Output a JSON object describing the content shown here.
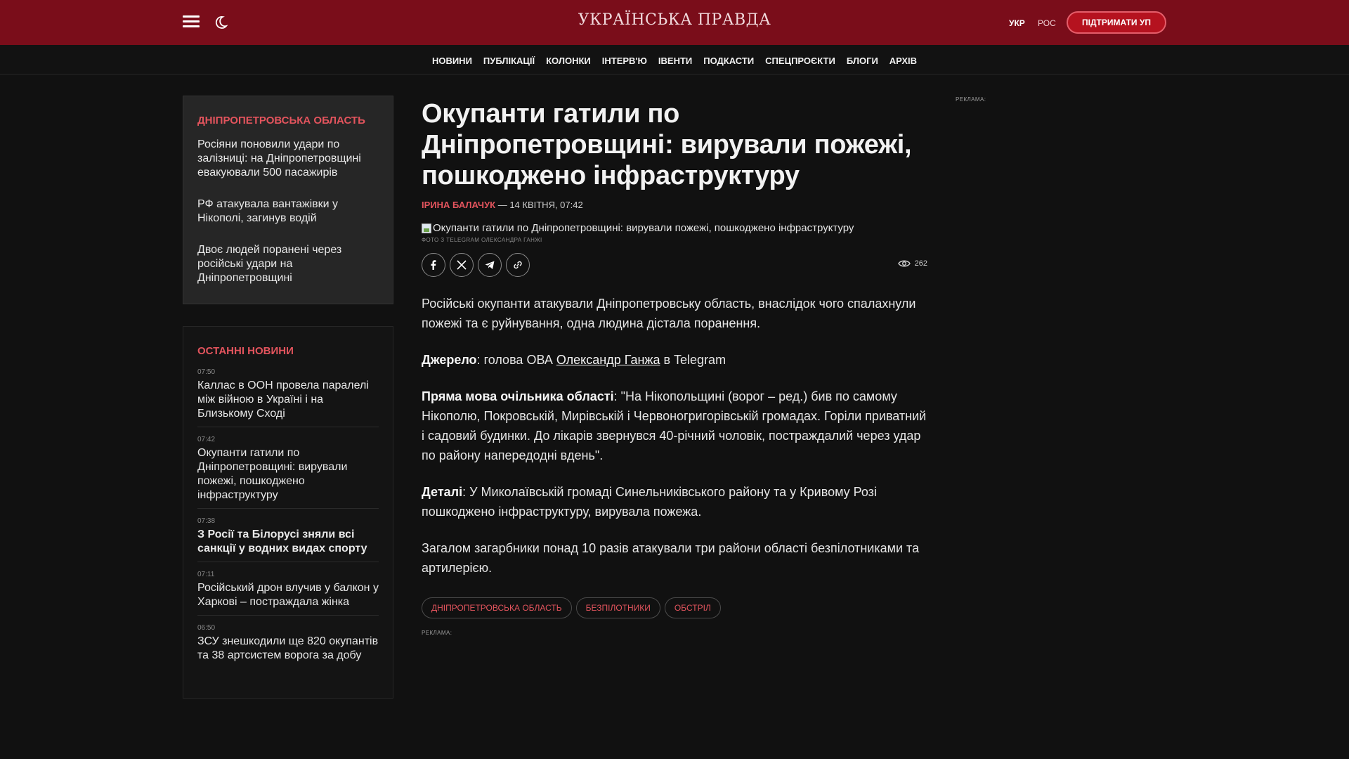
{
  "header": {
    "logo": "УКРАЇНСЬКА ПРАВДА",
    "lang_ukr": "УКР",
    "lang_ros": "РОС",
    "support": "ПІДТРИМАТИ УП",
    "accent": "#7a0d1a"
  },
  "nav": {
    "items": [
      "НОВИНИ",
      "ПУБЛІКАЦІЇ",
      "КОЛОНКИ",
      "ІНТЕРВ'Ю",
      "ІВЕНТИ",
      "ПОДКАСТИ",
      "СПЕЦПРОЄКТИ",
      "БЛОГИ",
      "АРХІВ"
    ]
  },
  "region": {
    "title": "ДНІПРОПЕТРОВСЬКА ОБЛАСТЬ",
    "items": [
      "Росіяни поновили удари по залізниці: на Дніпропетровщині евакуювали 500 пасажирів",
      "РФ атакувала вантажівки у Нікополі, загинув водій",
      "Двоє людей поранені через російські удари на Дніпропетровщині"
    ]
  },
  "latest": {
    "title": "ОСТАННІ НОВИНИ",
    "items": [
      {
        "time": "07:50",
        "title": "Каллас в ООН провела паралелі між війною в Україні і на Близькому Сході"
      },
      {
        "time": "07:42",
        "title": "Окупанти гатили по Дніпропетровщині: вирували пожежі, пошкоджено інфраструктуру"
      },
      {
        "time": "07:38",
        "title": "З Росії та Білорусі зняли всі санкції у водних видах спорту"
      },
      {
        "time": "07:11",
        "title": "Російський дрон влучив у балкон у Харкові – постраждала жінка"
      },
      {
        "time": "06:50",
        "title": "ЗСУ знешкодили ще 820 окупантів та 38 артсистем ворога за добу"
      }
    ]
  },
  "article": {
    "title": "Окупанти гатили по Дніпропетровщині: вирували пожежі, пошкоджено інфраструктуру",
    "author": "ІРИНА БАЛАЧУК",
    "date": " — 14 КВІТНЯ, 07:42",
    "image_alt": "Окупанти гатили по Дніпропетровщині: вирували пожежі, пошкоджено інфраструктуру",
    "photo_credit": "ФОТО З TELEGRAM ОЛЕКСАНДРА ГАНЖІ",
    "views": "262",
    "lead": "Російські окупанти атакували Дніпропетровську область, внаслідок чого спалахнули пожежі та є руйнування, одна людина дістала поранення.",
    "source_label": "Джерело",
    "source_pre": ": голова ОВА ",
    "source_link": "Олександр Ганжа",
    "source_post": " в Telegram",
    "quote_label": "Пряма мова очільника області",
    "quote_text": ": \"На Нікопольщині (ворог – ред.) бив по самому Нікополю, Покровській, Мирівській і Червоногригорівській громадах. Горіли приватний і садовий будинки. До лікарів звернувся 40-річний чоловік, постраждалий через удар по району напередодні вдень\".",
    "details_label": "Деталі",
    "details_text": ": У Миколаївській громаді Синельниківського району та у Кривому Розі пошкоджено інфраструктуру, вирувала пожежа.",
    "summary": "Загалом загарбники понад 10 разів атакували три райони області безпілотниками та артилерією.",
    "tags": [
      "ДНІПРОПЕТРОВСЬКА ОБЛАСТЬ",
      "БЕЗПІЛОТНИКИ",
      "ОБСТРІЛ"
    ]
  },
  "ads": {
    "label": "РЕКЛАМА:"
  },
  "icons": {
    "menu": "menu-icon",
    "night": "moon-icon",
    "facebook": "facebook-icon",
    "x": "x-icon",
    "telegram": "telegram-icon",
    "link": "link-icon",
    "views": "eye-icon"
  }
}
